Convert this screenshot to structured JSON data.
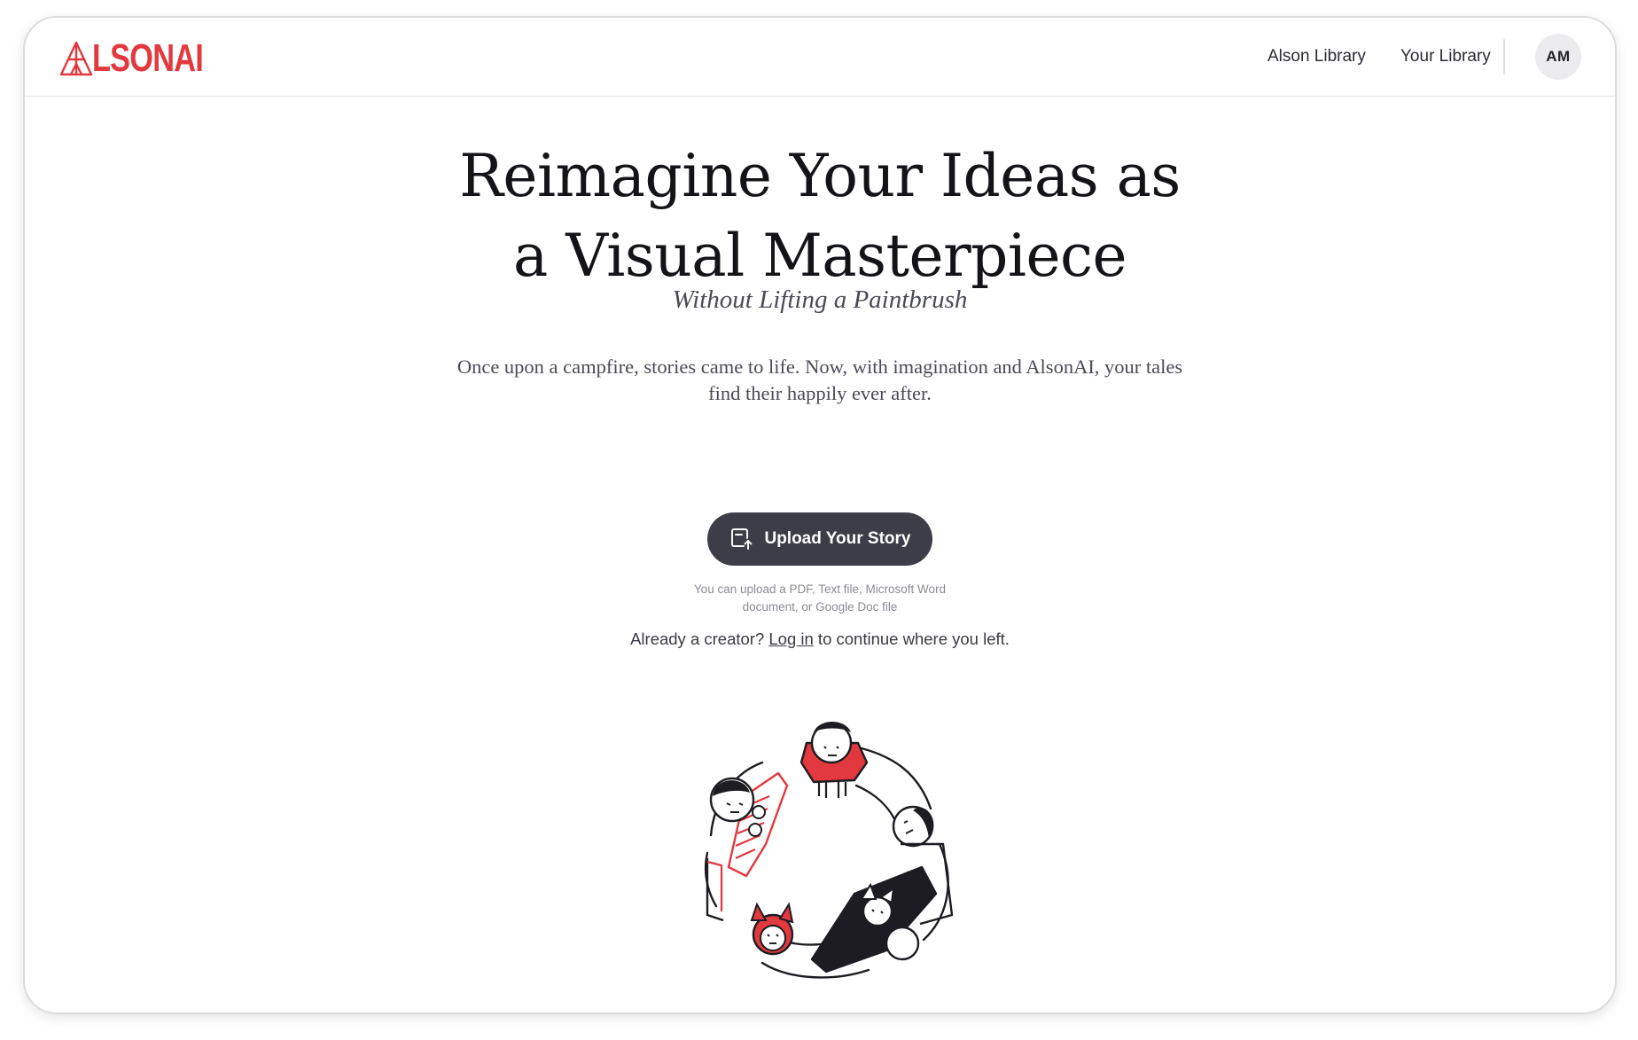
{
  "header": {
    "logo_text": "LSONAI",
    "nav": [
      "Alson Library",
      "Your Library"
    ],
    "avatar_initials": "AM"
  },
  "hero": {
    "title_line1": "Reimagine Your Ideas as",
    "title_line2": "a Visual Masterpiece",
    "subtitle": "Without Lifting a Paintbrush",
    "lede_line1": "Once upon a campfire, stories came to life. Now, with imagination and AlsonAI, your tales",
    "lede_line2": "find their happily ever after.",
    "upload_label": "Upload Your Story",
    "hint_line1": "You can upload a PDF, Text file, Microsoft Word",
    "hint_line2": "document, or Google Doc file",
    "login_prefix": "Already a creator? ",
    "login_link": "Log in",
    "login_suffix": " to continue where you left."
  },
  "colors": {
    "brand_red": "#e2393f",
    "button_dark": "#3d3d48"
  },
  "icons": {
    "logo": "tent-icon",
    "upload": "upload-document-icon"
  }
}
